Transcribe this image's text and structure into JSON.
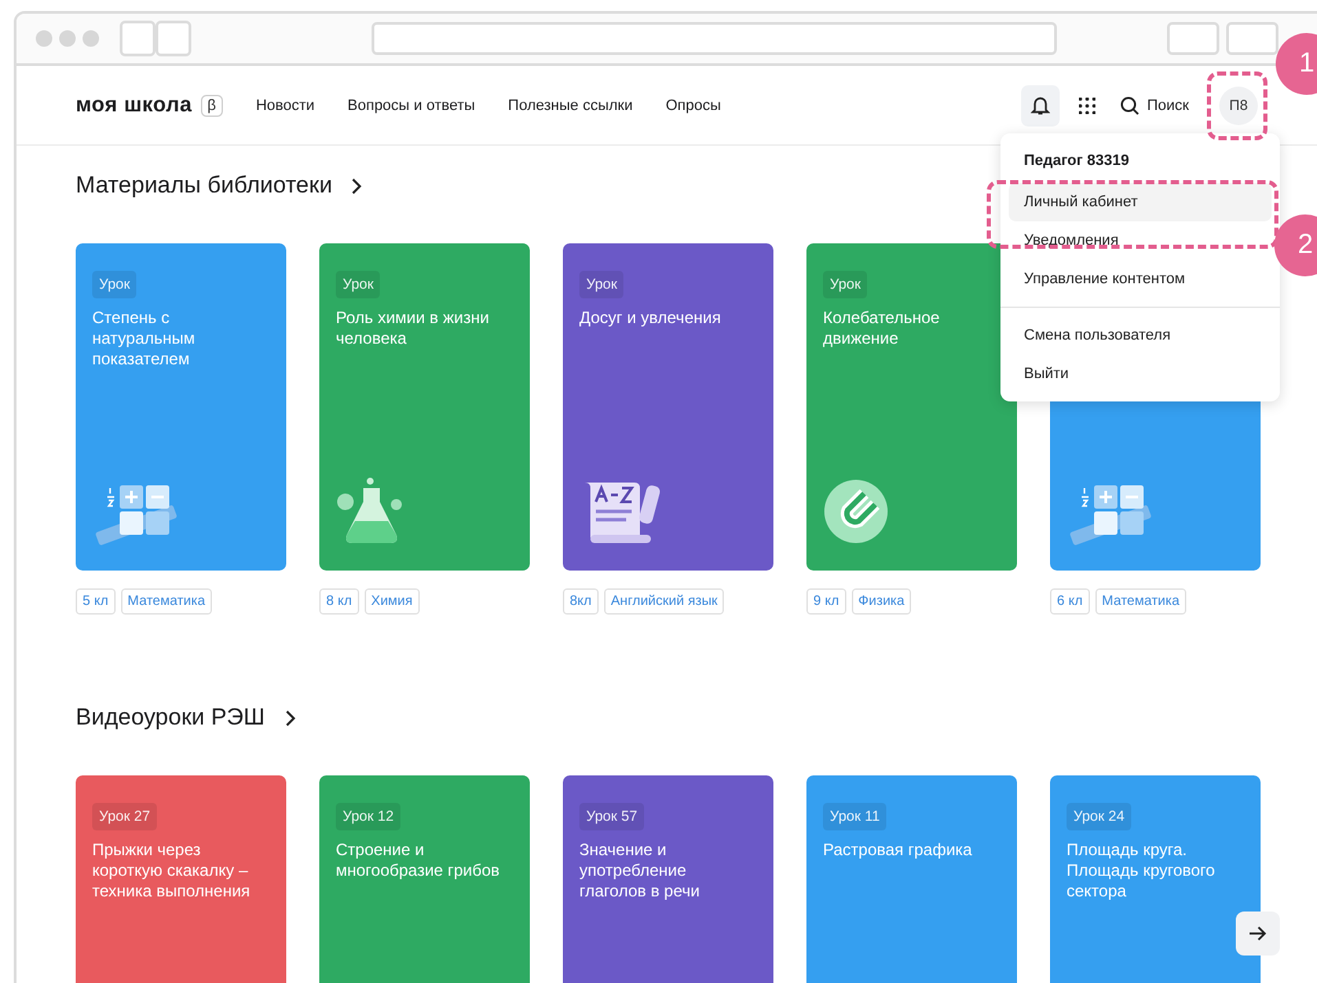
{
  "header": {
    "logo": "моя школа",
    "beta_badge": "β",
    "nav": [
      "Новости",
      "Вопросы и ответы",
      "Полезные ссылки",
      "Опросы"
    ],
    "search_label": "Поиск",
    "avatar": "П8"
  },
  "user_menu": {
    "user_name": "Педагог 83319",
    "groups": [
      {
        "items": [
          {
            "label": "Личный кабинет",
            "selected": true
          },
          {
            "label": "Уведомления",
            "selected": false
          },
          {
            "label": "Управление контентом",
            "selected": false
          }
        ]
      },
      {
        "items": [
          {
            "label": "Смена пользователя",
            "selected": false
          },
          {
            "label": "Выйти",
            "selected": false
          }
        ]
      }
    ]
  },
  "sections": [
    {
      "title": "Материалы библиотеки",
      "cards": [
        {
          "badge": "Урок",
          "title": "Степень с натуральным показателем",
          "color": "#359ff0",
          "kind": "math",
          "tags": [
            "5 кл",
            "Математика"
          ]
        },
        {
          "badge": "Урок",
          "title": "Роль химии в жизни человека",
          "color": "#2eaa62",
          "kind": "chemistry",
          "tags": [
            "8 кл",
            "Химия"
          ]
        },
        {
          "badge": "Урок",
          "title": "Досуг и увлечения",
          "color": "#6b59c7",
          "kind": "language",
          "tags": [
            "8кл",
            "Английский язык"
          ]
        },
        {
          "badge": "Урок",
          "title": "Колебательное движение",
          "color": "#2eaa62",
          "kind": "physics",
          "tags": [
            "9 кл",
            "Физика"
          ]
        },
        {
          "color": "#359ff0",
          "kind": "math",
          "tags": [
            "6 кл",
            "Математика"
          ]
        }
      ]
    },
    {
      "title": "Видеоуроки РЭШ",
      "cards": [
        {
          "badge": "Урок 27",
          "title": "Прыжки через короткую скакалку – техника выполнения",
          "color": "#e85a5e"
        },
        {
          "badge": "Урок 12",
          "title": "Строение и многообразие грибов",
          "color": "#2eaa62"
        },
        {
          "badge": "Урок 57",
          "title": "Значение и употребление глаголов в речи",
          "color": "#6b59c7"
        },
        {
          "badge": "Урок 11",
          "title": "Растровая графика",
          "color": "#359ff0"
        },
        {
          "badge": "Урок 24",
          "title": "Площадь круга. Площадь кругового сектора",
          "color": "#359ff0"
        }
      ]
    }
  ],
  "annotations": [
    {
      "number": "1"
    },
    {
      "number": "2"
    }
  ]
}
